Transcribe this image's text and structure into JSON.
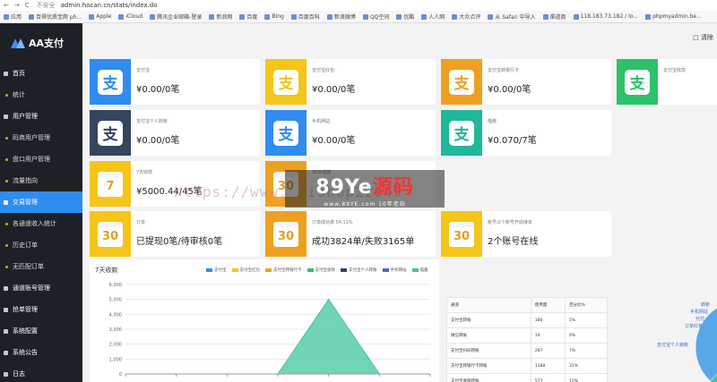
{
  "browser": {
    "nav_back": "←",
    "nav_forward": "→",
    "nav_reload": "C",
    "secure_label": "不安全",
    "url": "admin.hocan.cn/stats/index.do",
    "bookmarks": [
      "应用",
      "百得优质宝爬 ph...",
      "Apple",
      "iCloud",
      "腾讯企业邮箱-登录",
      "新浪网",
      "百度",
      "Bing",
      "百度百科",
      "新浪微博",
      "QQ空间",
      "优酷",
      "人人网",
      "大众点评",
      "从 Safari 中导入",
      "渠道商",
      "118.183.73.182 / lo...",
      "phpmyadmin.be..."
    ]
  },
  "sidebar": {
    "title": "AA支付",
    "items": [
      {
        "label": "首页",
        "type": "main"
      },
      {
        "label": "统计",
        "type": "sub"
      },
      {
        "label": "用户管理",
        "type": "main"
      },
      {
        "label": "码商用户管理",
        "type": "sub"
      },
      {
        "label": "盘口用户管理",
        "type": "sub"
      },
      {
        "label": "流量指向",
        "type": "sub"
      },
      {
        "label": "交易管理",
        "type": "main",
        "active": true
      },
      {
        "label": "各通道收入统计",
        "type": "sub"
      },
      {
        "label": "历史订单",
        "type": "sub"
      },
      {
        "label": "无匹配订单",
        "type": "sub"
      },
      {
        "label": "通道账号管理",
        "type": "main"
      },
      {
        "label": "抢单管理",
        "type": "main"
      },
      {
        "label": "系统配置",
        "type": "main"
      },
      {
        "label": "系统公告",
        "type": "main"
      },
      {
        "label": "日志",
        "type": "main"
      }
    ]
  },
  "topbar": {
    "action": "□ 清除"
  },
  "cards": [
    {
      "label": "支付宝",
      "value": "¥0.00/0笔",
      "color": "blue",
      "icon": "alipay-icon",
      "glyph": "支"
    },
    {
      "label": "支付宝红包",
      "value": "¥0.00/0笔",
      "color": "yellow",
      "icon": "alipay-icon",
      "glyph": "支"
    },
    {
      "label": "支付宝转银行卡",
      "value": "¥0.00/0笔",
      "color": "orange",
      "icon": "alipay-icon",
      "glyph": "支"
    },
    {
      "label": "支付宝收款",
      "value": "",
      "color": "green",
      "icon": "alipay-icon",
      "glyph": "支"
    },
    {
      "label": "支付宝个人转账",
      "value": "¥0.00/0笔",
      "color": "navy",
      "icon": "alipay-icon",
      "glyph": "支"
    },
    {
      "label": "手机网站",
      "value": "¥0.00/0笔",
      "color": "blue",
      "icon": "alipay-icon",
      "glyph": "支"
    },
    {
      "label": "喵酱",
      "value": "¥0.070/7笔",
      "color": "teal",
      "icon": "alipay-icon",
      "glyph": "支"
    },
    {
      "label": "7天收款",
      "value": "¥5000.44/45笔",
      "color": "yellow",
      "icon": "calendar-icon",
      "glyph": "7"
    },
    {
      "label": "30天收款",
      "value": "",
      "color": "orange",
      "icon": "calendar-icon",
      "glyph": "30"
    },
    {
      "label": "订单",
      "value": "已提现0笔/待审核0笔",
      "color": "yellow",
      "icon": "calendar-icon",
      "glyph": "30"
    },
    {
      "label": "订单成功率 54.11%",
      "value": "成功3824单/失败3165单",
      "color": "orange",
      "icon": "calendar-icon",
      "glyph": "30"
    },
    {
      "label": "账号/2个账号开启接单",
      "value": "2个账号在线",
      "color": "yellow",
      "icon": "calendar-icon",
      "glyph": "30"
    }
  ],
  "chart_data": {
    "type": "area",
    "title": "7天收款",
    "categories": [
      "",
      "",
      "",
      "",
      "",
      "",
      ""
    ],
    "series": [
      {
        "name": "支付宝",
        "color": "#2f8cf0",
        "values": [
          0,
          0,
          0,
          0,
          0,
          0,
          0
        ]
      },
      {
        "name": "支付宝红包",
        "color": "#f5c518",
        "values": [
          0,
          0,
          0,
          0,
          0,
          0,
          0
        ]
      },
      {
        "name": "支付宝转银行卡",
        "color": "#f0a020",
        "values": [
          0,
          0,
          0,
          0,
          0,
          0,
          0
        ]
      },
      {
        "name": "支付宝收款",
        "color": "#2cc26a",
        "values": [
          0,
          0,
          0,
          0,
          0,
          0,
          0
        ]
      },
      {
        "name": "支付宝个人转账",
        "color": "#34455e",
        "values": [
          0,
          0,
          0,
          0,
          0,
          0,
          0
        ]
      },
      {
        "name": "手机网站",
        "color": "#3a6fc4",
        "values": [
          0,
          0,
          0,
          0,
          0,
          0,
          0
        ]
      },
      {
        "name": "喵酱",
        "color": "#43c59e",
        "values": [
          0,
          0,
          0,
          0,
          5000,
          0,
          0
        ]
      }
    ],
    "yticks": [
      0,
      1000,
      2000,
      3000,
      4000,
      5000,
      6000
    ],
    "ytick_labels": [
      "0",
      "1,000",
      "2,000",
      "3,000",
      "4,000",
      "5,000",
      "6,000"
    ],
    "ylim": [
      0,
      6000
    ],
    "grid": true,
    "legend": "top"
  },
  "table": {
    "headers": [
      "通道",
      "使用量",
      "百分比%"
    ],
    "rows": [
      [
        "支付宝转账",
        "180",
        "5%"
      ],
      [
        "微信转账",
        "19",
        "0%"
      ],
      [
        "支付宝扫码转账",
        "287",
        "7%"
      ],
      [
        "支付宝转银行卡转账",
        "1188",
        "31%"
      ],
      [
        "支付宝收款转账",
        "577",
        "15%"
      ]
    ]
  },
  "pie": {
    "labels": [
      "支付宝个人转账",
      "支付宝收款",
      "转账",
      "手机网站",
      "代付",
      "订单红包"
    ],
    "slices": [
      {
        "value": 31,
        "color": "#2f8cf0"
      },
      {
        "value": 15,
        "color": "#34455e"
      },
      {
        "value": 7,
        "color": "#f0a020"
      },
      {
        "value": 5,
        "color": "#2cc26a"
      },
      {
        "value": 4,
        "color": "#43c59e"
      },
      {
        "value": 38,
        "color": "#5aa7e8"
      }
    ]
  },
  "watermark": {
    "text": "https://www.             /ishop22949",
    "logo_main": "89Ye",
    "logo_red": "源码",
    "logo_sub": "www.89YE.com   10年老站"
  }
}
